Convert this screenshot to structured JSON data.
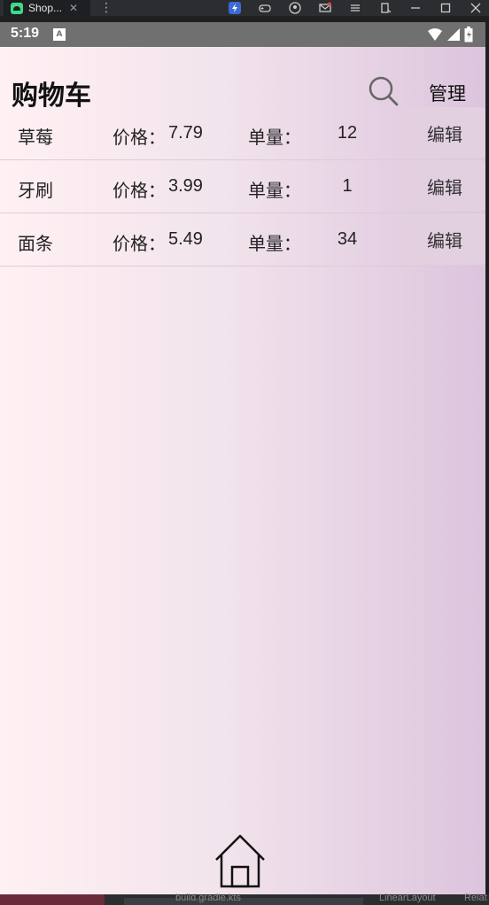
{
  "window": {
    "tab_title": "Shop...",
    "tab_close": "✕",
    "menu": "⋮"
  },
  "status": {
    "time": "5:19",
    "badge": "A"
  },
  "header": {
    "title": "购物车",
    "manage": "管理"
  },
  "labels": {
    "price": "价格：",
    "quantity": "单量：",
    "edit": "编辑"
  },
  "items": [
    {
      "name": "草莓",
      "price": "7.79",
      "quantity": "12"
    },
    {
      "name": "牙刷",
      "price": "3.99",
      "quantity": "1"
    },
    {
      "name": "面条",
      "price": "5.49",
      "quantity": "34"
    }
  ],
  "ide_footer": {
    "left": "build.gradle.kts",
    "mid": "LinearLayout",
    "right": "Relat"
  },
  "colors": {
    "accent": "#e2cfe0",
    "gradient_start": "#fff0f3",
    "gradient_end": "#dcc4dd"
  }
}
